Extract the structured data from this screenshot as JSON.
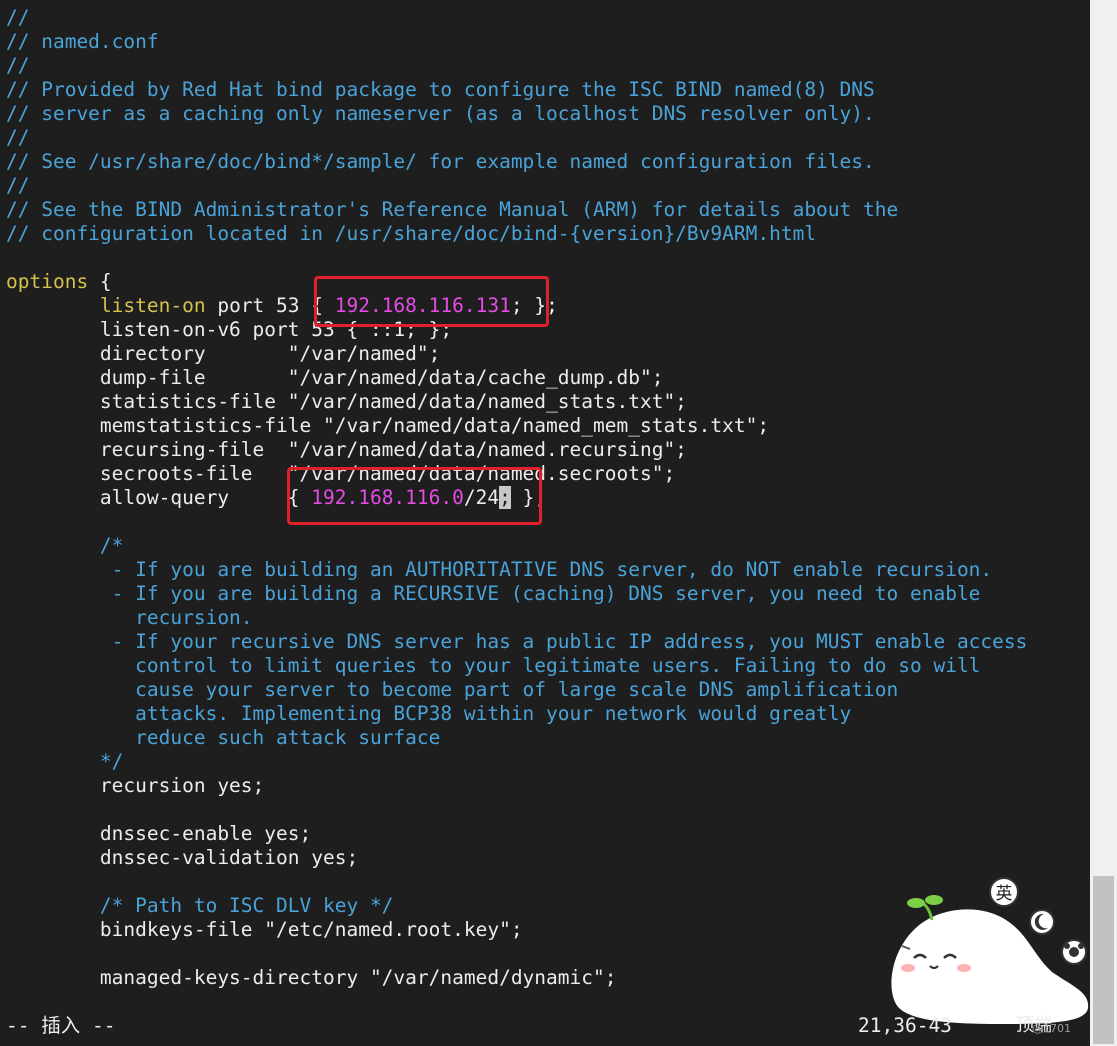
{
  "editor": {
    "lines": [
      {
        "type": "comment",
        "text": "//"
      },
      {
        "type": "comment",
        "text": "// named.conf"
      },
      {
        "type": "comment",
        "text": "//"
      },
      {
        "type": "comment",
        "text": "// Provided by Red Hat bind package to configure the ISC BIND named(8) DNS"
      },
      {
        "type": "comment",
        "text": "// server as a caching only nameserver (as a localhost DNS resolver only)."
      },
      {
        "type": "comment",
        "text": "//"
      },
      {
        "type": "comment",
        "text": "// See /usr/share/doc/bind*/sample/ for example named configuration files."
      },
      {
        "type": "comment",
        "text": "//"
      },
      {
        "type": "comment",
        "text": "// See the BIND Administrator's Reference Manual (ARM) for details about the"
      },
      {
        "type": "comment",
        "text": "// configuration located in /usr/share/doc/bind-{version}/Bv9ARM.html"
      },
      {
        "type": "blank",
        "text": ""
      },
      {
        "type": "options",
        "keyword": "options",
        "rest": " {"
      },
      {
        "type": "listen",
        "indent": "        ",
        "keyword": "listen-on",
        "mid": " port 53 { ",
        "ip": "192.168.116.131",
        "end": "; };"
      },
      {
        "type": "plain",
        "text": "        listen-on-v6 port 53 { ::1; };"
      },
      {
        "type": "plain",
        "text": "        directory       \"/var/named\";"
      },
      {
        "type": "plain",
        "text": "        dump-file       \"/var/named/data/cache_dump.db\";"
      },
      {
        "type": "plain",
        "text": "        statistics-file \"/var/named/data/named_stats.txt\";"
      },
      {
        "type": "plain",
        "text": "        memstatistics-file \"/var/named/data/named_mem_stats.txt\";"
      },
      {
        "type": "plain",
        "text": "        recursing-file  \"/var/named/data/named.recursing\";"
      },
      {
        "type": "plain",
        "text": "        secroots-file   \"/var/named/data/named.secroots\";"
      },
      {
        "type": "allow",
        "prefix": "        allow-query     { ",
        "ip": "192.168.116.0",
        "cidr": "/24",
        "cursor": ";",
        "end": " };"
      },
      {
        "type": "blank",
        "text": ""
      },
      {
        "type": "comment",
        "text": "        /*"
      },
      {
        "type": "comment",
        "text": "         - If you are building an AUTHORITATIVE DNS server, do NOT enable recursion."
      },
      {
        "type": "comment",
        "text": "         - If you are building a RECURSIVE (caching) DNS server, you need to enable"
      },
      {
        "type": "comment",
        "text": "           recursion."
      },
      {
        "type": "comment",
        "text": "         - If your recursive DNS server has a public IP address, you MUST enable access"
      },
      {
        "type": "comment",
        "text": "           control to limit queries to your legitimate users. Failing to do so will"
      },
      {
        "type": "comment",
        "text": "           cause your server to become part of large scale DNS amplification"
      },
      {
        "type": "comment",
        "text": "           attacks. Implementing BCP38 within your network would greatly"
      },
      {
        "type": "comment",
        "text": "           reduce such attack surface"
      },
      {
        "type": "comment",
        "text": "        */"
      },
      {
        "type": "plain",
        "text": "        recursion yes;"
      },
      {
        "type": "blank",
        "text": ""
      },
      {
        "type": "plain",
        "text": "        dnssec-enable yes;"
      },
      {
        "type": "plain",
        "text": "        dnssec-validation yes;"
      },
      {
        "type": "blank",
        "text": ""
      },
      {
        "type": "comment",
        "text": "        /* Path to ISC DLV key */"
      },
      {
        "type": "plain",
        "text": "        bindkeys-file \"/etc/named.root.key\";"
      },
      {
        "type": "blank",
        "text": ""
      },
      {
        "type": "plain",
        "text": "        managed-keys-directory \"/var/named/dynamic\";"
      }
    ]
  },
  "status": {
    "mode": "-- 插入 --",
    "position": "21,36-43",
    "percent": "顶端",
    "watermark": "@1701"
  },
  "sticker": {
    "badge_text": "英",
    "icons": [
      "moon-icon",
      "settings-icon"
    ]
  },
  "colors": {
    "background": "#1e1e1e",
    "comment": "#4aa3d8",
    "keyword": "#d6c24a",
    "ip": "#e54be5",
    "highlight_box": "#e0202a"
  }
}
